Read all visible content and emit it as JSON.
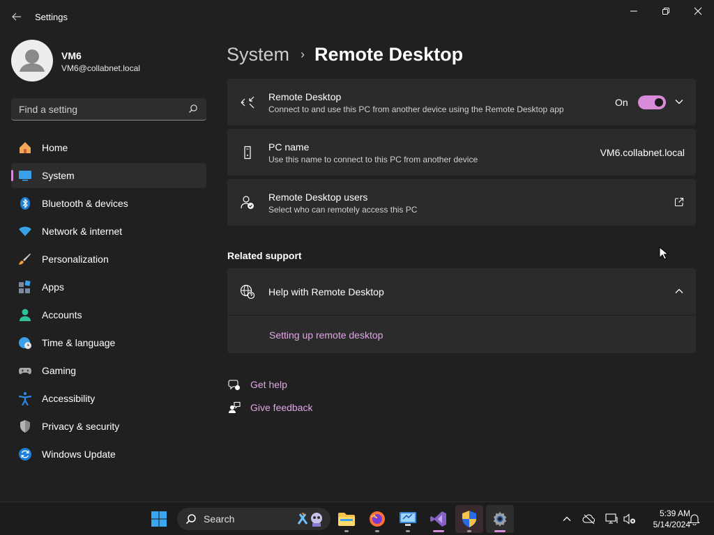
{
  "window": {
    "title": "Settings"
  },
  "profile": {
    "name": "VM6",
    "email": "VM6@collabnet.local"
  },
  "search": {
    "placeholder": "Find a setting"
  },
  "sidebar": {
    "items": [
      {
        "label": "Home",
        "icon": "home-icon",
        "selected": false
      },
      {
        "label": "System",
        "icon": "system-icon",
        "selected": true
      },
      {
        "label": "Bluetooth & devices",
        "icon": "bluetooth-icon",
        "selected": false
      },
      {
        "label": "Network & internet",
        "icon": "wifi-icon",
        "selected": false
      },
      {
        "label": "Personalization",
        "icon": "brush-icon",
        "selected": false
      },
      {
        "label": "Apps",
        "icon": "apps-icon",
        "selected": false
      },
      {
        "label": "Accounts",
        "icon": "accounts-icon",
        "selected": false
      },
      {
        "label": "Time & language",
        "icon": "globe-clock-icon",
        "selected": false
      },
      {
        "label": "Gaming",
        "icon": "gamepad-icon",
        "selected": false
      },
      {
        "label": "Accessibility",
        "icon": "accessibility-icon",
        "selected": false
      },
      {
        "label": "Privacy & security",
        "icon": "shield-icon",
        "selected": false
      },
      {
        "label": "Windows Update",
        "icon": "update-icon",
        "selected": false
      }
    ]
  },
  "breadcrumb": {
    "parent": "System",
    "separator": "›",
    "current": "Remote Desktop"
  },
  "settings": {
    "remote_desktop": {
      "title": "Remote Desktop",
      "subtitle": "Connect to and use this PC from another device using the Remote Desktop app",
      "state_label": "On",
      "enabled": true
    },
    "pc_name": {
      "title": "PC name",
      "subtitle": "Use this name to connect to this PC from another device",
      "value": "VM6.collabnet.local"
    },
    "users": {
      "title": "Remote Desktop users",
      "subtitle": "Select who can remotely access this PC"
    }
  },
  "related_support": {
    "heading": "Related support",
    "help_title": "Help with Remote Desktop",
    "links": [
      "Setting up remote desktop"
    ]
  },
  "footer": {
    "get_help": "Get help",
    "give_feedback": "Give feedback"
  },
  "taskbar": {
    "search_label": "Search",
    "time": "5:39 AM",
    "date": "5/14/2024"
  },
  "colors": {
    "accent": "#d88bd8",
    "link": "#e2a6e8",
    "background": "#202020",
    "card": "#2b2b2b"
  }
}
